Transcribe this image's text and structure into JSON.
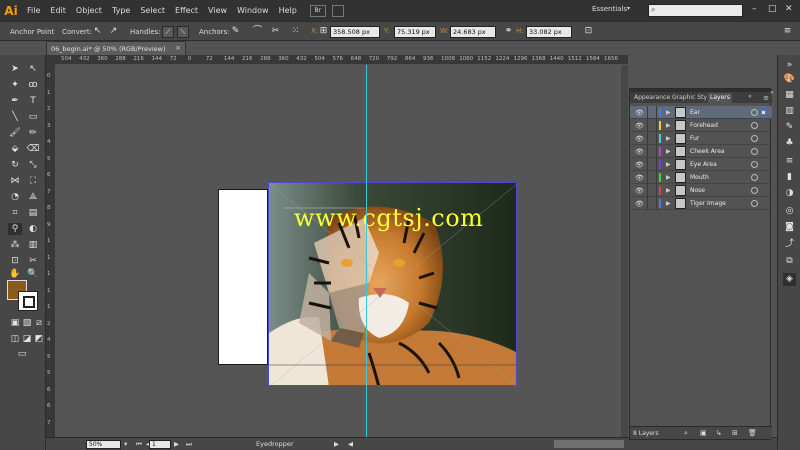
{
  "app": {
    "logo": "Ai"
  },
  "menu": {
    "items": [
      "File",
      "Edit",
      "Object",
      "Type",
      "Select",
      "Effect",
      "View",
      "Window",
      "Help"
    ],
    "bridge_label": "Br",
    "workspace": "Essentials",
    "search_placeholder": ""
  },
  "control_bar": {
    "anchor_point_label": "Anchor Point",
    "convert_label": "Convert:",
    "handles_label": "Handles:",
    "anchors_label": "Anchors:",
    "x_tag": "X:",
    "x_value": "358.508 px",
    "y_tag": "Y:",
    "y_value": "75.319 px",
    "w_tag": "W:",
    "w_value": "24.683 px",
    "h_tag": "H:",
    "h_value": "33.082 px"
  },
  "document": {
    "tab_title": "06_begin.ai* @ 50% (RGB/Preview)",
    "close": "×",
    "watermark": "www.cgtsj.com"
  },
  "ruler": {
    "h_ticks": [
      "504",
      "432",
      "360",
      "288",
      "216",
      "144",
      "72",
      "0",
      "72",
      "144",
      "216",
      "288",
      "360",
      "432",
      "504",
      "576",
      "648",
      "720",
      "792",
      "864",
      "936",
      "1008",
      "1080",
      "1152",
      "1224",
      "1296",
      "1368",
      "1440",
      "1512",
      "1584",
      "1656"
    ],
    "v_ticks": [
      "0",
      "1",
      "2",
      "3",
      "4",
      "5",
      "6",
      "7",
      "8",
      "9",
      "1",
      "1",
      "1",
      "1",
      "1",
      "2",
      "4",
      "5",
      "5",
      "6",
      "6",
      "7"
    ]
  },
  "status_bar": {
    "zoom": "50%",
    "page": "1",
    "tool_name": "Eyedropper"
  },
  "layers_panel": {
    "tabs": [
      "Appearance",
      "Graphic Sty",
      "Layers"
    ],
    "active_tab": "Layers",
    "footer_count": "8 Layers",
    "layers": [
      {
        "name": "Ear",
        "color": "#4a7bd8",
        "selected": true
      },
      {
        "name": "Forehead",
        "color": "#e8d040",
        "selected": false
      },
      {
        "name": "Fur",
        "color": "#40d0d8",
        "selected": false
      },
      {
        "name": "Cheek Area",
        "color": "#c040c8",
        "selected": false
      },
      {
        "name": "Eye Area",
        "color": "#7040e0",
        "selected": false
      },
      {
        "name": "Mouth",
        "color": "#40d040",
        "selected": false
      },
      {
        "name": "Nose",
        "color": "#e04040",
        "selected": false
      },
      {
        "name": "Tiger Image",
        "color": "#4a7bd8",
        "selected": false
      }
    ]
  },
  "colors": {
    "fill": "#8a5a1e",
    "stroke": "#ffffff",
    "guide": "#3ac8d8",
    "selection": "#4a4ad0",
    "watermark": "#ffff33"
  }
}
